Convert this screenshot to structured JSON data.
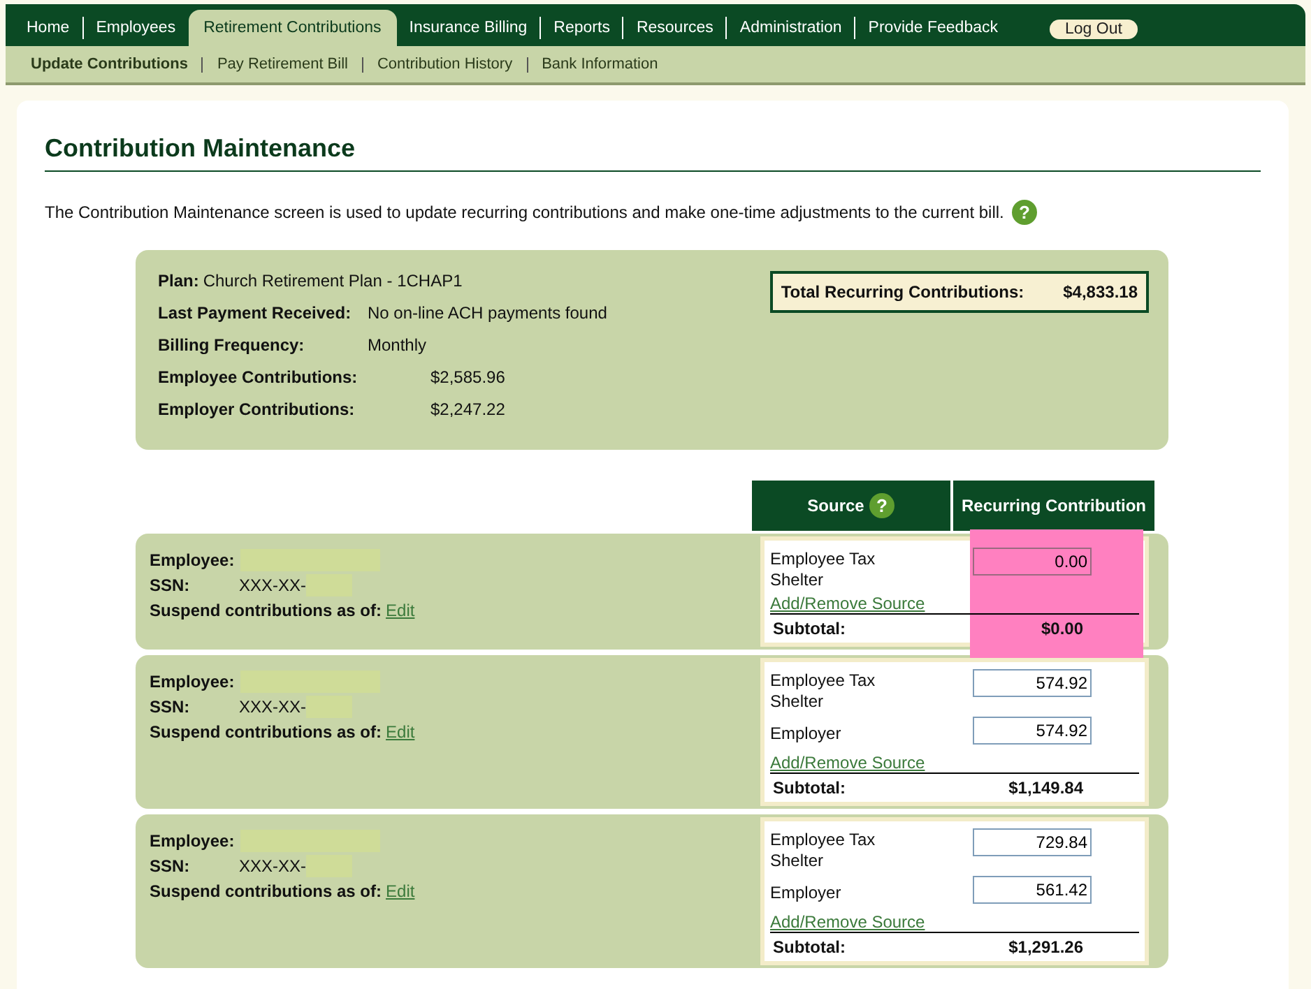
{
  "nav": {
    "tabs": [
      {
        "label": "Home",
        "selected": false
      },
      {
        "label": "Employees",
        "selected": false
      },
      {
        "label": "Retirement Contributions",
        "selected": true
      },
      {
        "label": "Insurance Billing",
        "selected": false
      },
      {
        "label": "Reports",
        "selected": false
      },
      {
        "label": "Resources",
        "selected": false
      },
      {
        "label": "Administration",
        "selected": false
      },
      {
        "label": "Provide Feedback",
        "selected": false
      }
    ],
    "logout": "Log Out"
  },
  "subnav": [
    {
      "label": "Update Contributions",
      "selected": true
    },
    {
      "label": "Pay Retirement Bill",
      "selected": false
    },
    {
      "label": "Contribution History",
      "selected": false
    },
    {
      "label": "Bank Information",
      "selected": false
    }
  ],
  "title": "Contribution Maintenance",
  "help_mark": "?",
  "description": "The Contribution Maintenance screen is used to update recurring contributions and make one-time adjustments to the current bill.",
  "summary": {
    "plan_label": "Plan:",
    "plan_value": "Church Retirement Plan - 1CHAP1",
    "rows": [
      {
        "label": "Last Payment Received:",
        "value": "No on-line ACH payments found",
        "kind": "text"
      },
      {
        "label": "Billing Frequency:",
        "value": "Monthly",
        "kind": "text"
      },
      {
        "label": "Employee Contributions:",
        "value": "$2,585.96",
        "kind": "amount"
      },
      {
        "label": "Employer Contributions:",
        "value": "$2,247.22",
        "kind": "amount"
      }
    ],
    "total_label": "Total Recurring Contributions:",
    "total_value": "$4,833.18"
  },
  "table": {
    "columns": [
      "Source",
      "Recurring Contribution"
    ],
    "help_mark": "?"
  },
  "employees": [
    {
      "employee_label": "Employee:",
      "ssn_label": "SSN:",
      "ssn_value": "XXX-XX-",
      "suspend_label": "Suspend contributions as of:",
      "edit_link": "Edit",
      "redacted": true,
      "highlighted": true,
      "sources": [
        {
          "name": "Employee Tax Shelter",
          "amount": "0.00"
        }
      ],
      "add_remove": "Add/Remove Source",
      "subtotal_label": "Subtotal:",
      "subtotal": "$0.00"
    },
    {
      "employee_label": "Employee:",
      "ssn_label": "SSN:",
      "ssn_value": "XXX-XX-",
      "suspend_label": "Suspend contributions as of:",
      "edit_link": "Edit",
      "redacted": true,
      "highlighted": false,
      "sources": [
        {
          "name": "Employee Tax Shelter",
          "amount": "574.92"
        },
        {
          "name": "Employer",
          "amount": "574.92"
        }
      ],
      "add_remove": "Add/Remove Source",
      "subtotal_label": "Subtotal:",
      "subtotal": "$1,149.84"
    },
    {
      "employee_label": "Employee:",
      "ssn_label": "SSN:",
      "ssn_value": "XXX-XX-",
      "suspend_label": "Suspend contributions as of:",
      "edit_link": "Edit",
      "redacted": true,
      "highlighted": false,
      "sources": [
        {
          "name": "Employee Tax Shelter",
          "amount": "729.84"
        },
        {
          "name": "Employer",
          "amount": "561.42"
        }
      ],
      "add_remove": "Add/Remove Source",
      "subtotal_label": "Subtotal:",
      "subtotal": "$1,291.26"
    }
  ]
}
